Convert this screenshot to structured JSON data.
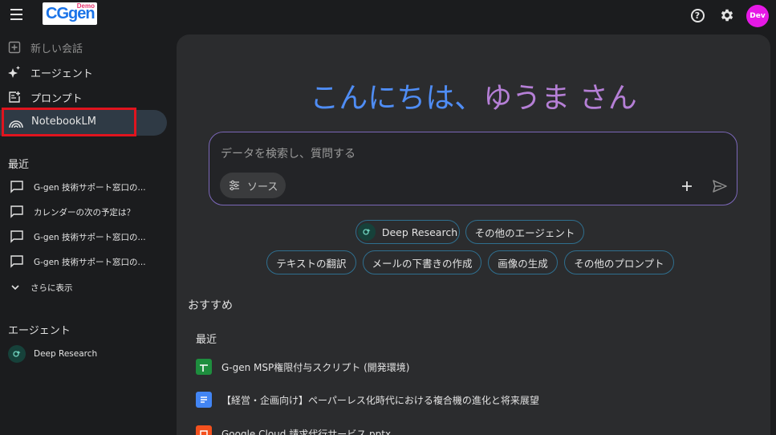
{
  "header": {
    "logo_text": "CGgen",
    "logo_badge": "Demo",
    "avatar_initials": "Dev"
  },
  "sidebar": {
    "items": [
      {
        "label": "新しい会話",
        "icon": "new-chat-icon",
        "disabled": true
      },
      {
        "label": "エージェント",
        "icon": "sparkle-icon"
      },
      {
        "label": "プロンプト",
        "icon": "prompt-icon"
      },
      {
        "label": "NotebookLM",
        "icon": "notebooklm-icon",
        "active": true
      }
    ],
    "recent_title": "最近",
    "recent": [
      "G-gen 技術サポート窓口の...",
      "カレンダーの次の予定は？",
      "G-gen 技術サポート窓口の...",
      "G-gen 技術サポート窓口の..."
    ],
    "show_more": "さらに表示",
    "agents_title": "エージェント",
    "agents": [
      "Deep Research"
    ]
  },
  "main": {
    "greeting_part1": "こんにちは、",
    "greeting_part2": "ゆうま さん",
    "input_placeholder": "データを検索し、質問する",
    "source_label": "ソース",
    "chips_row1": [
      "Deep Research",
      "その他のエージェント"
    ],
    "chips_row2": [
      "テキストの翻訳",
      "メールの下書きの作成",
      "画像の生成",
      "その他のプロンプト"
    ],
    "recommend_title": "おすすめ",
    "recent_subtitle": "最近",
    "recent_files": [
      {
        "name": "G-gen MSP権限付与スクリプト (開発環境)",
        "type": "sheets",
        "color": "#1e8e3e"
      },
      {
        "name": "【経営・企画向け】ペーパーレス化時代における複合機の進化と将来展望",
        "type": "docs",
        "color": "#4285f4"
      },
      {
        "name": "Google Cloud 請求代行サービス.pptx",
        "type": "slides",
        "color": "#f4511e"
      }
    ]
  },
  "colors": {
    "background": "#1b1c1e",
    "panel": "#2b2c2e",
    "greeting_blue": "#4f8df5",
    "greeting_purple": "#b57fd6",
    "highlight": "#e0141e",
    "avatar": "#e619e6"
  }
}
